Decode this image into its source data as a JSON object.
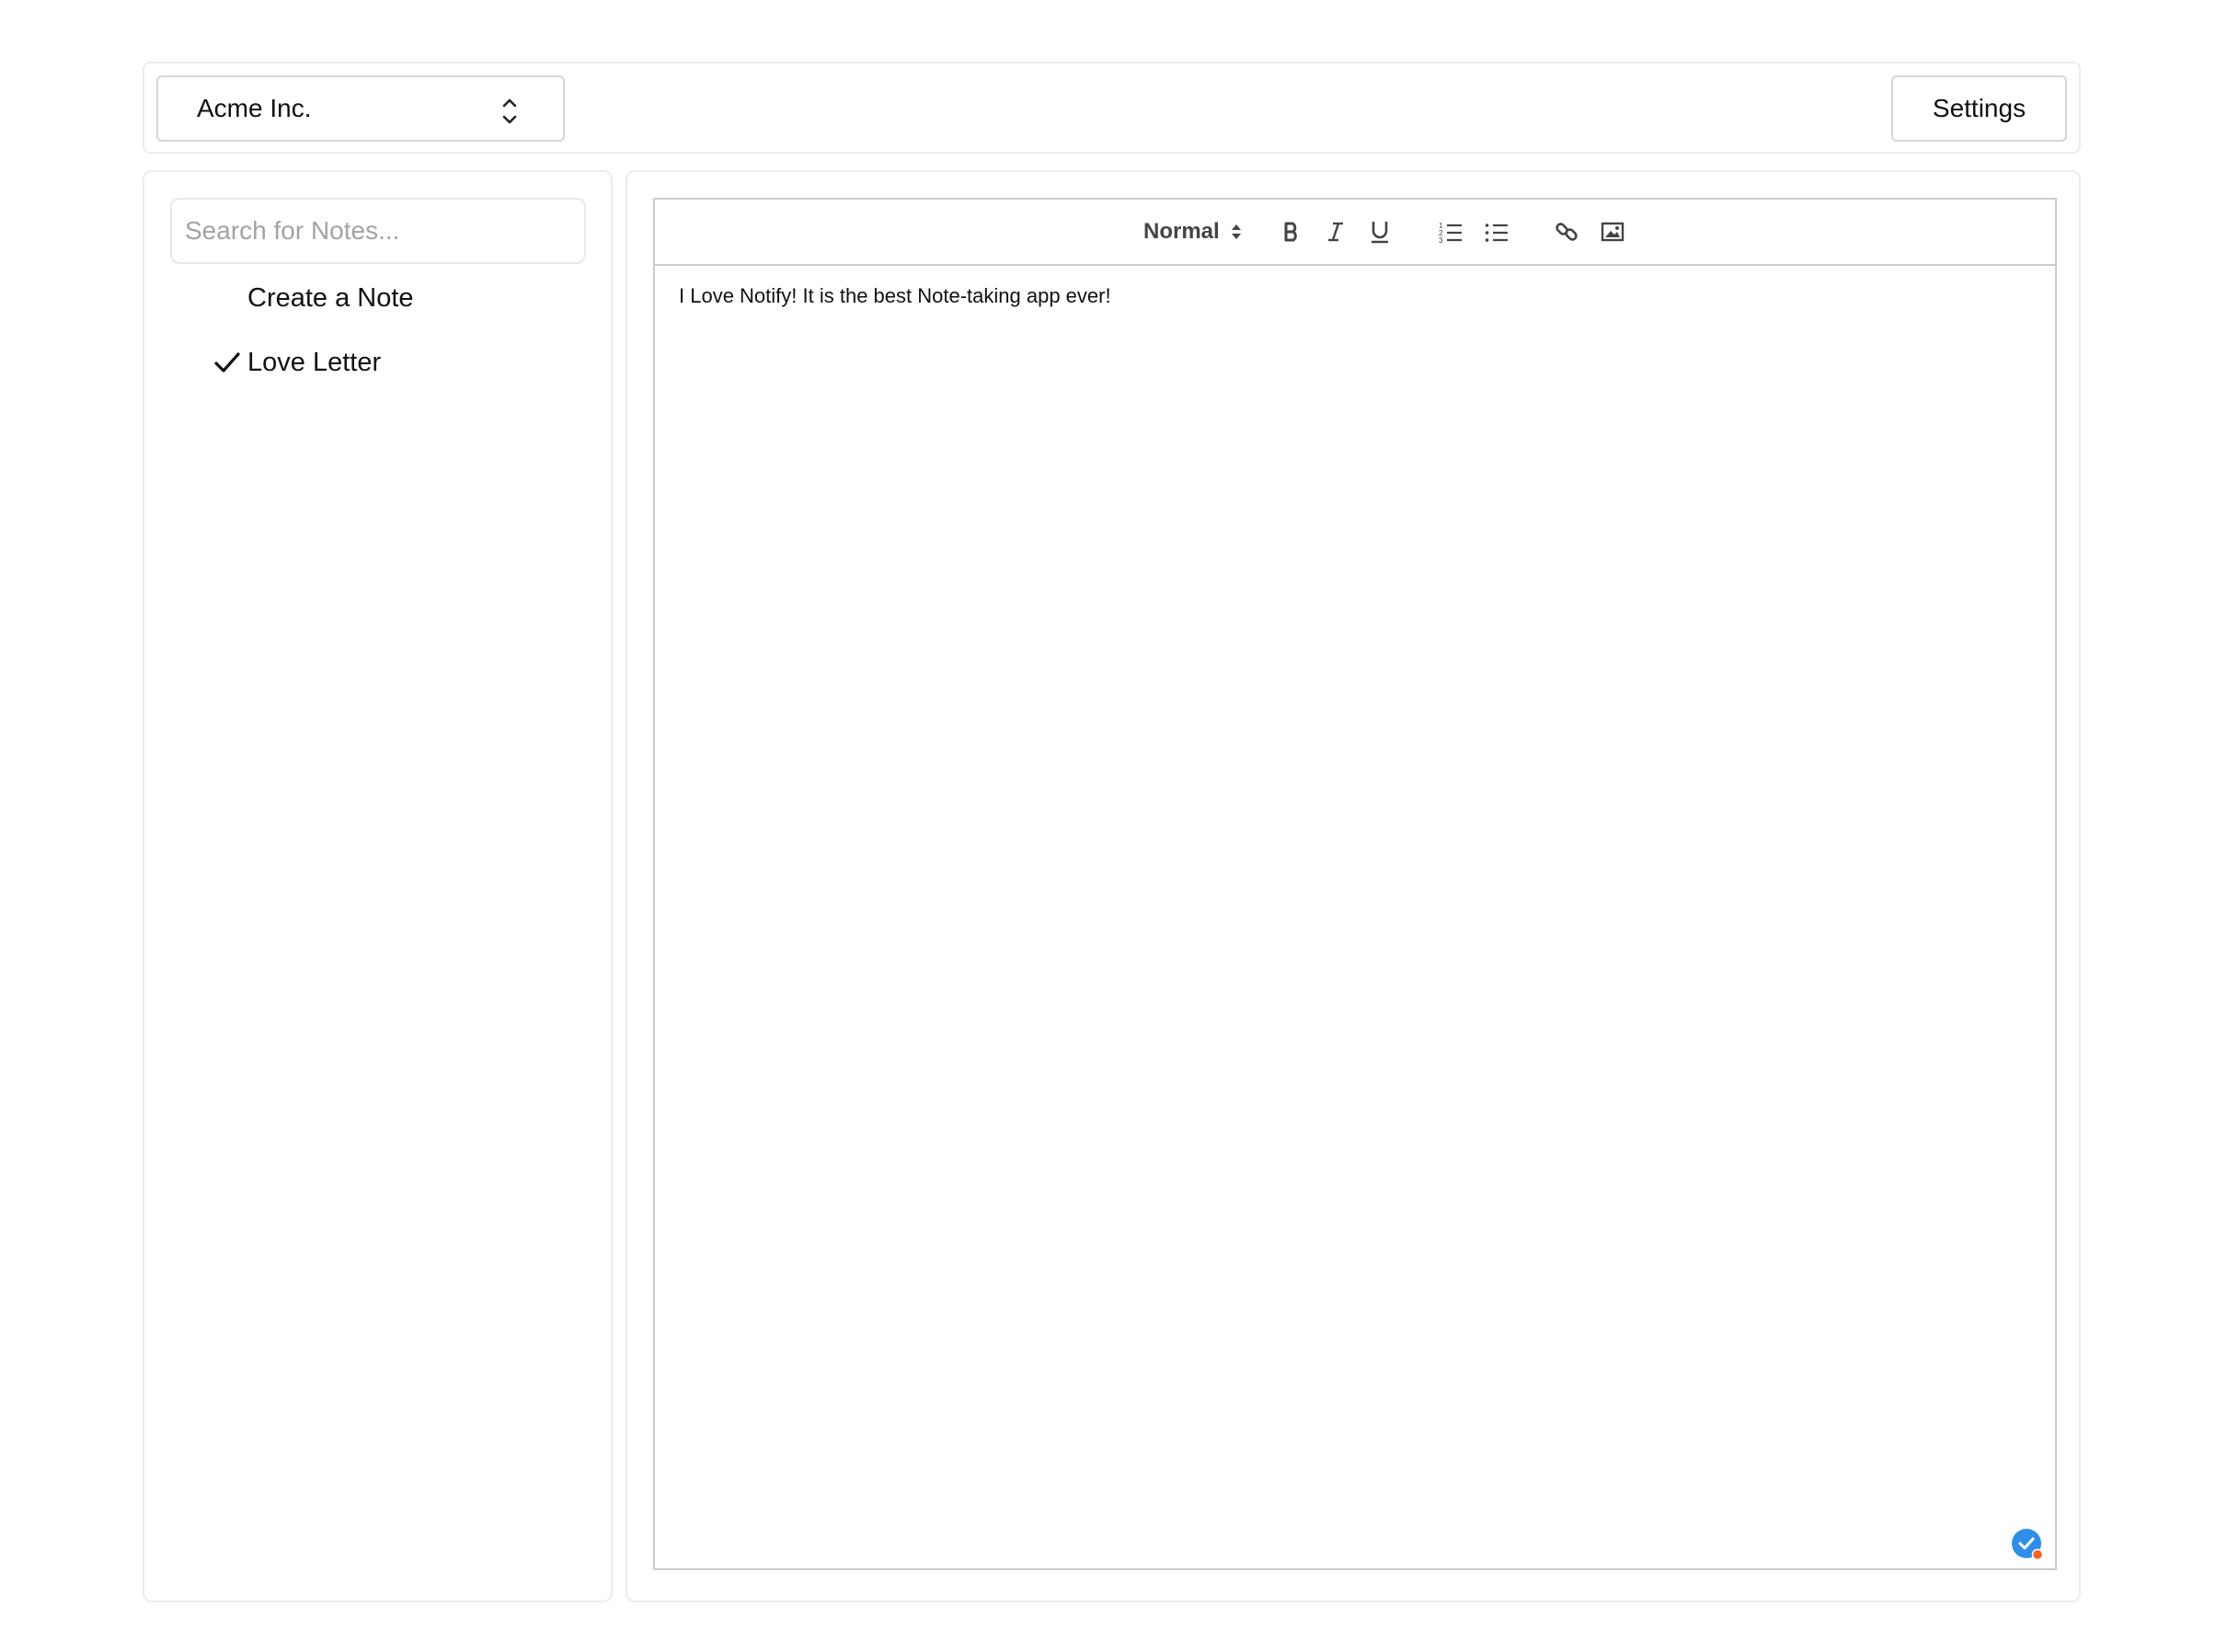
{
  "org_switcher": {
    "selected": "Acme Inc."
  },
  "header": {
    "settings_label": "Settings"
  },
  "sidebar": {
    "search_placeholder": "Search for Notes...",
    "create_label": "Create a Note",
    "notes": [
      {
        "title": "Love Letter",
        "selected": true
      }
    ]
  },
  "editor": {
    "toolbar": {
      "header_format": "Normal",
      "buttons": [
        "bold-icon",
        "italic-icon",
        "underline-icon",
        "ordered-list-icon",
        "bullet-list-icon",
        "link-icon",
        "image-icon"
      ]
    },
    "content": "I Love Notify! It is the best Note-taking app ever!",
    "status_icon": "check-circle-icon",
    "accent_color": "#2f8fe8",
    "status_dot_color": "#f26522"
  }
}
